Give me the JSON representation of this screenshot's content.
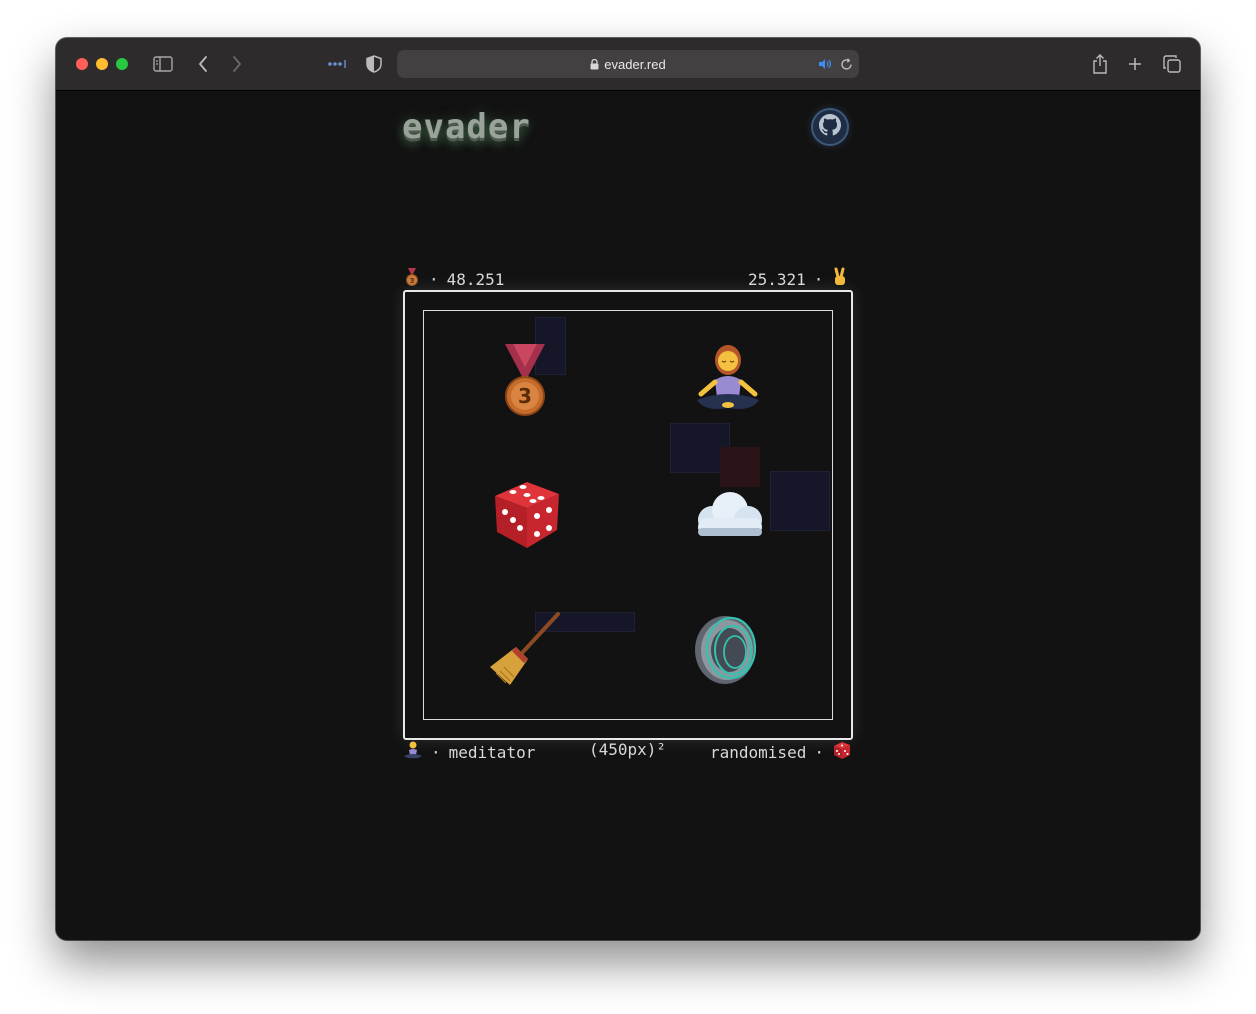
{
  "browser": {
    "url": "evader.red"
  },
  "page": {
    "logo": "evader",
    "github_label": "GitHub",
    "score_left_value": "48.251",
    "score_right_value": "25.321",
    "separator": "·",
    "player_left": "meditator",
    "board_size": "(450px)²",
    "player_right": "randomised"
  },
  "icons": {
    "score_left": "third-place-medal-icon",
    "score_right": "victory-hand-icon",
    "player_left": "meditating-person-icon",
    "player_right": "dice-icon",
    "pieces": [
      "medal-icon",
      "meditator-icon",
      "dice-icon",
      "cloud-icon",
      "broom-icon",
      "speaker-icon"
    ]
  },
  "colors": {
    "background": "#121212",
    "board_border": "#e8e8e8",
    "ghost": "#161629"
  }
}
